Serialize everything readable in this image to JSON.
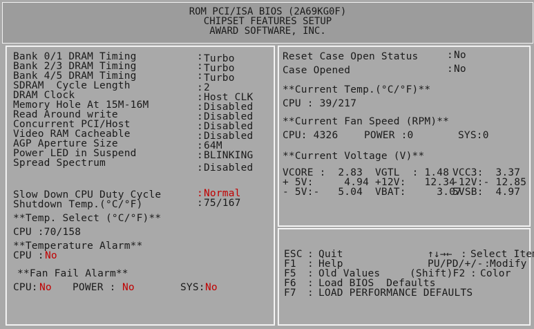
{
  "header": {
    "line1": "ROM PCI/ISA BIOS (2A69KG0F)",
    "line2": "CHIPSET FEATURES SETUP",
    "line3": "AWARD SOFTWARE, INC."
  },
  "settings": [
    {
      "label": "Bank 0/1 DRAM Timing",
      "value": "Turbo"
    },
    {
      "label": "Bank 2/3 DRAM Timing",
      "value": "Turbo"
    },
    {
      "label": "Bank 4/5 DRAM Timing",
      "value": "Turbo"
    },
    {
      "label": "SDRAM  Cycle Length",
      "value": "2"
    },
    {
      "label": "DRAM Clock",
      "value": "Host CLK"
    },
    {
      "label": "Memory Hole At 15M-16M",
      "value": "Disabled"
    },
    {
      "label": "Read Around write",
      "value": "Disabled"
    },
    {
      "label": "Concurrent PCI/Host",
      "value": "Disabled"
    },
    {
      "label": "Video RAM Cacheable",
      "value": "Disabled"
    },
    {
      "label": "AGP Aperture Size",
      "value": "64M"
    },
    {
      "label": "Power LED in Suspend",
      "value": "BLINKING"
    },
    {
      "label": "Spread Spectrum",
      "value": "Disabled"
    },
    {
      "label": "Slow Down CPU Duty Cycle",
      "value": "Normal"
    },
    {
      "label": "Shutdown Temp.(°C/°F)",
      "value": "75/167"
    }
  ],
  "temp_select": {
    "title": "**Temp. Select (°C/°F)**",
    "cpu": "CPU :70/158"
  },
  "temp_alarm": {
    "title": "**Temperature Alarm**",
    "cpu_label": "CPU :",
    "cpu_value": "No"
  },
  "fan_fail": {
    "title": "**Fan Fail Alarm**",
    "cpu_label": "CPU:",
    "cpu_value": "No",
    "power_label": "POWER :",
    "power_value": "No",
    "sys_label": "SYS:",
    "sys_value": "No"
  },
  "case": {
    "reset_label": "Reset Case Open Status",
    "reset_value": "No",
    "opened_label": "Case Opened",
    "opened_value": "No"
  },
  "current_temp": {
    "title": "**Current Temp.(°C/°F)**",
    "cpu": "CPU : 39/217"
  },
  "fan_speed": {
    "title": "**Current Fan Speed (RPM)**",
    "cpu": "CPU: 4326",
    "power": "POWER :0",
    "sys": "SYS:0"
  },
  "voltage": {
    "title": "**Current Voltage (V)**",
    "row1": {
      "a": "VCORE :  2.83",
      "b": "VGTL  : 1.48",
      "c": "VCC3:  3.37"
    },
    "row2": {
      "a": "+ 5V:     4.94",
      "b": "+12V:   12.34",
      "c": "-12V:- 12.85"
    },
    "row3": {
      "a": "- 5V:-   5.04",
      "b": "VBAT:     3.07",
      "c": "5VSB:  4.97"
    }
  },
  "help": [
    {
      "key": "ESC",
      "text": "Quit",
      "key2": "↑↓→←",
      "text2": "Select Item"
    },
    {
      "key": "F1",
      "text": "Help",
      "key2": "PU/PD/+/-",
      "text2": "Modify"
    },
    {
      "key": "F5",
      "text": "Old Values",
      "key2": "(Shift)F2",
      "text2": "Color"
    },
    {
      "key": "F6",
      "text": "Load BIOS  Defaults",
      "key2": "",
      "text2": ""
    },
    {
      "key": "F7",
      "text": "LOAD PERFORMANCE DEFAULTS",
      "key2": "",
      "text2": ""
    }
  ],
  "colors": {
    "background": "#a9a9a9",
    "highlight": "#c00000",
    "text": "#1a1a1a"
  }
}
